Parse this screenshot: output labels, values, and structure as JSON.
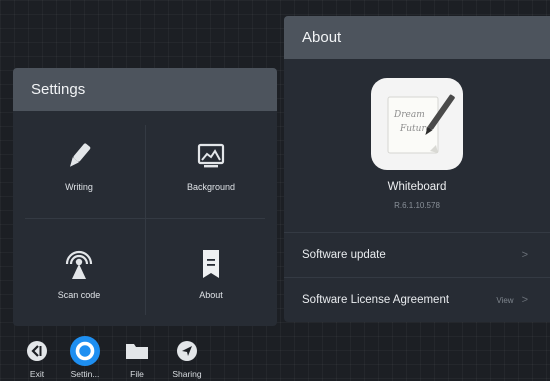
{
  "settings": {
    "title": "Settings",
    "items": [
      {
        "label": "Writing",
        "icon": "brush-icon"
      },
      {
        "label": "Background",
        "icon": "image-icon"
      },
      {
        "label": "Scan code",
        "icon": "broadcast-icon"
      },
      {
        "label": "About",
        "icon": "document-icon"
      }
    ]
  },
  "about": {
    "title": "About",
    "app_icon_text": [
      "Dream",
      "Future"
    ],
    "app_name": "Whiteboard",
    "version": "R.6.1.10.578",
    "rows": [
      {
        "label": "Software update",
        "chevron": ">"
      },
      {
        "label": "Software License Agreement",
        "extra": "View",
        "chevron": ">"
      }
    ]
  },
  "taskbar": {
    "items": [
      {
        "label": "Exit",
        "icon": "exit-icon"
      },
      {
        "label": "Settin...",
        "icon": "settings-icon"
      },
      {
        "label": "File",
        "icon": "folder-icon"
      },
      {
        "label": "Sharing",
        "icon": "send-icon"
      }
    ]
  },
  "colors": {
    "panel": "#272c34",
    "header": "#4d545d",
    "accent": "#1e8ff1"
  }
}
